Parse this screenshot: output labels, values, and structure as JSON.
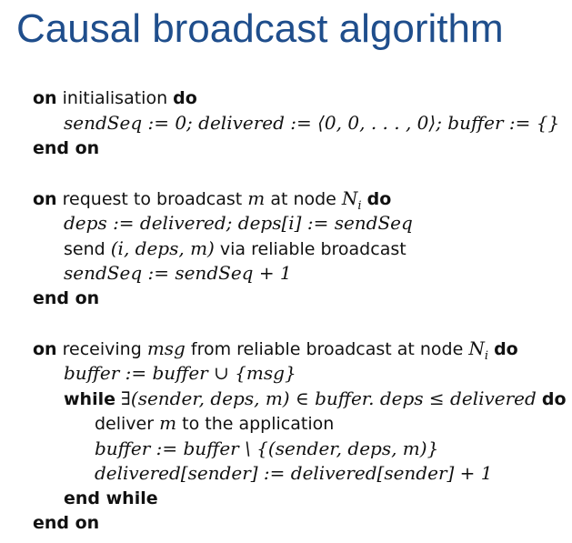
{
  "title": "Causal broadcast algorithm",
  "blocks": {
    "init": {
      "l1_on": "on",
      "l1_text": "initialisation",
      "l1_do": "do",
      "l2_math": "sendSeq := 0;  delivered := ⟨0, 0, . . . , 0⟩;  buffer := {}",
      "l3_end": "end on"
    },
    "request": {
      "l1_on": "on",
      "l1_text_a": "request to broadcast",
      "l1_m": "m",
      "l1_text_b": "at node",
      "l1_node": "N",
      "l1_sub": "i",
      "l1_do": "do",
      "l2_math": "deps := delivered; deps[i] := sendSeq",
      "l3_text_a": "send",
      "l3_math": "(i, deps, m)",
      "l3_text_b": "via reliable broadcast",
      "l4_math": "sendSeq := sendSeq + 1",
      "l5_end": "end on"
    },
    "receive": {
      "l1_on": "on",
      "l1_text_a": "receiving",
      "l1_msg": "msg",
      "l1_text_b": "from reliable broadcast at node",
      "l1_node": "N",
      "l1_sub": "i",
      "l1_do": "do",
      "l2_math": "buffer := buffer ∪ {msg}",
      "l3_while": "while",
      "l3_math": "∃(sender, deps, m) ∈ buffer. deps ≤ delivered",
      "l3_do": "do",
      "l4_text_a": "deliver",
      "l4_m": "m",
      "l4_text_b": "to the application",
      "l5_math": "buffer := buffer \\ {(sender, deps, m)}",
      "l6_math": "delivered[sender] := delivered[sender] + 1",
      "l7_end": "end while",
      "l8_end": "end on"
    }
  }
}
